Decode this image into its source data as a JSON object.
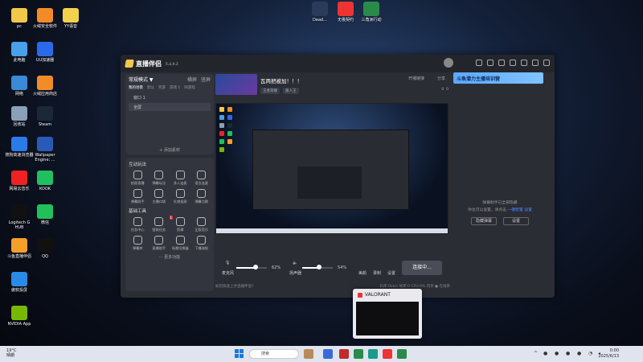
{
  "desktop": {
    "icons": [
      {
        "label": "pc",
        "color": "#f2c84b"
      },
      {
        "label": "火绒安全软件",
        "color": "#f28c28"
      },
      {
        "label": "YY语音",
        "color": "#f2d24b"
      },
      {
        "label": "此电脑",
        "color": "#4aa0e8"
      },
      {
        "label": "UU加速器",
        "color": "#2a6ae8"
      },
      {
        "label": "网络",
        "color": "#3a8ad8"
      },
      {
        "label": "火绒应用商店",
        "color": "#f28c28"
      },
      {
        "label": "回收站",
        "color": "#8aa0b8"
      },
      {
        "label": "Steam",
        "color": "#1b2838"
      },
      {
        "label": "搜狗高速浏览器",
        "color": "#2a7ae8"
      },
      {
        "label": "Wallpaper Engine: ...",
        "color": "#2a5ab8"
      },
      {
        "label": "网易云音乐",
        "color": "#e22"
      },
      {
        "label": "KOOK",
        "color": "#20c060"
      },
      {
        "label": "Logitech G HUB",
        "color": "#111"
      },
      {
        "label": "微信",
        "color": "#22c05a"
      },
      {
        "label": "斗鱼直播伴侣",
        "color": "#f2a02a"
      },
      {
        "label": "QQ",
        "color": "#111"
      },
      {
        "label": "傲软投屏",
        "color": "#2a8ae8"
      },
      {
        "label": "NVIDIA App",
        "color": "#76b900"
      }
    ],
    "top_icons": [
      {
        "label": "Dead...",
        "color": "#2a3a5a"
      },
      {
        "label": "无畏契约",
        "color": "#e33"
      },
      {
        "label": "三角洲行动",
        "color": "#2a8a4a"
      }
    ]
  },
  "app": {
    "title": "直播伴侣",
    "version": "5.4.9.2",
    "banner": "斗鱼潜力主播培训营",
    "left": {
      "mode": "常规模式 ▼",
      "mode_links": [
        "横屏",
        "竖屏"
      ],
      "scene_tabs": [
        "我的场景",
        "默认",
        "完游",
        "游戏 1",
        "除游戏"
      ],
      "scenes": [
        "窗口 1",
        "全屏"
      ],
      "add_material": "+ 添加素材",
      "interactive_title": "互动玩法",
      "interactive": [
        "拍照直播",
        "弹幕玩法",
        "多人连麦",
        "语言连麦",
        "弹幕助手",
        "主播口袋",
        "礼物投屏",
        "弹幕点歌"
      ],
      "basic_title": "基础工具",
      "basic": [
        "任务中心",
        "营商任务",
        "剪辑",
        "正版音乐",
        "弹幕库",
        "直播助手",
        "场景切换器",
        "下播海报"
      ],
      "basic_badge": "1",
      "more": "··· 更多功能"
    },
    "stream": {
      "title": "瓦两把被加！！！",
      "tags": [
        "王者荣耀",
        "路人王"
      ],
      "open_link": "开播链接",
      "share": "分享",
      "views": [
        "0",
        "0"
      ]
    },
    "controls": {
      "mic_label": "麦克风",
      "mic_pct": "62%",
      "mic_level": 0.62,
      "speaker_label": "扬声器",
      "speaker_pct": "54%",
      "speaker_level": 0.54,
      "effects": "美颜",
      "record": "录制",
      "settings": "设置",
      "start": "连接中..."
    },
    "status": {
      "left": "如何快速上手直播伴侣？",
      "right": "码率:0kb/s  帧率:0  CPU:0%  内存  ● 在线率"
    },
    "right_panel": {
      "line1": "弹幕助手已全部隐藏",
      "line2_a": "你也可以设置，请点击",
      "line2_link": "一键配置",
      "line2_b": "设置",
      "btn_hide": "隐藏弹幕",
      "btn_settings": "设置"
    }
  },
  "popup": {
    "title": "VALORANT"
  },
  "taskbar": {
    "weather_temp": "19°C",
    "weather_desc": "晴朗",
    "search": "搜索",
    "time": "0:00",
    "date": "2025/6/13"
  }
}
